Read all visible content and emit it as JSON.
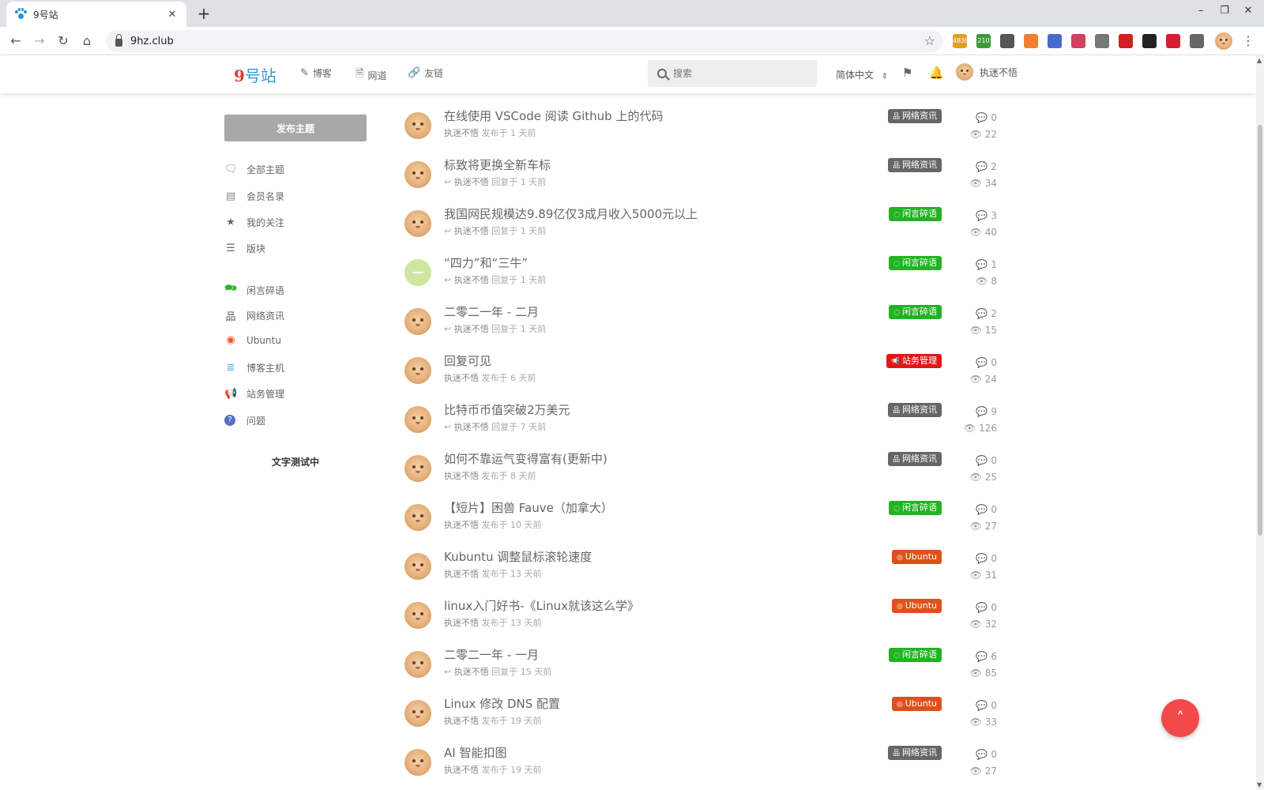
{
  "browser": {
    "tab_title": "9号站",
    "url": "9hz.club",
    "extensions": [
      {
        "name": "ext-badge-icon",
        "label": "4839",
        "color": "#e0a020"
      },
      {
        "name": "ext-badge-icon",
        "label": "210",
        "color": "#3a9a3a"
      },
      {
        "name": "mail-icon",
        "label": "",
        "color": "#555555"
      },
      {
        "name": "ext-icon",
        "label": "",
        "color": "#f08030"
      },
      {
        "name": "calendar-icon",
        "label": "",
        "color": "#4a6ad0"
      },
      {
        "name": "ext-icon",
        "label": "",
        "color": "#d04060"
      },
      {
        "name": "ext-icon",
        "label": "",
        "color": "#777777"
      },
      {
        "name": "ext-icon",
        "label": "",
        "color": "#d02020"
      },
      {
        "name": "ext-icon",
        "label": "",
        "color": "#222222"
      },
      {
        "name": "heart-icon",
        "label": "",
        "color": "#d02030"
      },
      {
        "name": "puzzle-icon",
        "label": "",
        "color": "#666666"
      }
    ]
  },
  "header": {
    "logo_num": "9",
    "logo_text": "号站",
    "nav": [
      {
        "label": "博客",
        "icon": "blog-icon"
      },
      {
        "label": "网道",
        "icon": "doc-icon"
      },
      {
        "label": "友链",
        "icon": "link-icon"
      }
    ],
    "search_placeholder": "搜索",
    "language": "简体中文",
    "username": "执迷不悟"
  },
  "sidebar": {
    "publish_label": "发布主题",
    "main_nav": [
      {
        "label": "全部主题",
        "icon": "comments-icon",
        "color": "#888888"
      },
      {
        "label": "会员名录",
        "icon": "address-book-icon",
        "color": "#888888"
      },
      {
        "label": "我的关注",
        "icon": "star-icon",
        "color": "#666666"
      },
      {
        "label": "版块",
        "icon": "list-icon",
        "color": "#666666"
      }
    ],
    "categories": [
      {
        "label": "闲言碎语",
        "icon": "chat-icon",
        "color": "#33b233"
      },
      {
        "label": "网络资讯",
        "icon": "sitemap-icon",
        "color": "#555555"
      },
      {
        "label": "Ubuntu",
        "icon": "ubuntu-icon",
        "color": "#e95420"
      },
      {
        "label": "博客主机",
        "icon": "server-icon",
        "color": "#4fb3d9"
      },
      {
        "label": "站务管理",
        "icon": "megaphone-icon",
        "color": "#e02020"
      },
      {
        "label": "问题",
        "icon": "question-icon",
        "color": "#5570c0"
      }
    ],
    "footer_text": "文字测试中"
  },
  "tag_styles": {
    "网络资讯": {
      "color": "#666666",
      "icon": "sitemap-icon",
      "glyph": "品"
    },
    "闲言碎语": {
      "color": "#22b322",
      "icon": "chat-icon",
      "glyph": "◌"
    },
    "站务管理": {
      "color": "#e01818",
      "icon": "megaphone-icon",
      "glyph": "📢"
    },
    "Ubuntu": {
      "color": "#e0501c",
      "icon": "ubuntu-icon",
      "glyph": "◎"
    }
  },
  "topics": [
    {
      "title": "在线使用 VSCode 阅读 Github 上的代码",
      "user": "执迷不悟",
      "action": "发布于 1 天前",
      "replied": false,
      "tag": "网络资讯",
      "replies": "0",
      "views": "22",
      "avatar": "face"
    },
    {
      "title": "标致将更换全新车标",
      "user": "执迷不悟",
      "action": "回复于 1 天前",
      "replied": true,
      "tag": "网络资讯",
      "replies": "2",
      "views": "34",
      "avatar": "face"
    },
    {
      "title": "我国网民规模达9.89亿仅3成月收入5000元以上",
      "user": "执迷不悟",
      "action": "回复于 1 天前",
      "replied": true,
      "tag": "闲言碎语",
      "replies": "3",
      "views": "40",
      "avatar": "face"
    },
    {
      "title": "“四力”和“三牛”",
      "user": "执迷不悟",
      "action": "回复于 1 天前",
      "replied": true,
      "tag": "闲言碎语",
      "replies": "1",
      "views": "8",
      "avatar": "green"
    },
    {
      "title": "二零二一年 - 二月",
      "user": "执迷不悟",
      "action": "回复于 1 天前",
      "replied": true,
      "tag": "闲言碎语",
      "replies": "2",
      "views": "15",
      "avatar": "face"
    },
    {
      "title": "回复可见",
      "user": "执迷不悟",
      "action": "发布于 6 天前",
      "replied": false,
      "tag": "站务管理",
      "replies": "0",
      "views": "24",
      "avatar": "face"
    },
    {
      "title": "比特币币值突破2万美元",
      "user": "执迷不悟",
      "action": "回复于 7 天前",
      "replied": true,
      "tag": "网络资讯",
      "replies": "9",
      "views": "126",
      "avatar": "face"
    },
    {
      "title": "如何不靠运气变得富有(更新中)",
      "user": "执迷不悟",
      "action": "发布于 8 天前",
      "replied": false,
      "tag": "网络资讯",
      "replies": "0",
      "views": "25",
      "avatar": "face"
    },
    {
      "title": "【短片】困兽 Fauve（加拿大）",
      "user": "执迷不悟",
      "action": "发布于 10 天前",
      "replied": false,
      "tag": "闲言碎语",
      "replies": "0",
      "views": "27",
      "avatar": "face"
    },
    {
      "title": "Kubuntu 调整鼠标滚轮速度",
      "user": "执迷不悟",
      "action": "发布于 13 天前",
      "replied": false,
      "tag": "Ubuntu",
      "replies": "0",
      "views": "31",
      "avatar": "face"
    },
    {
      "title": "linux入门好书-《Linux就该这么学》",
      "user": "执迷不悟",
      "action": "发布于 13 天前",
      "replied": false,
      "tag": "Ubuntu",
      "replies": "0",
      "views": "32",
      "avatar": "face"
    },
    {
      "title": "二零二一年 - 一月",
      "user": "执迷不悟",
      "action": "回复于 15 天前",
      "replied": true,
      "tag": "闲言碎语",
      "replies": "6",
      "views": "85",
      "avatar": "face"
    },
    {
      "title": "Linux 修改 DNS 配置",
      "user": "执迷不悟",
      "action": "发布于 19 天前",
      "replied": false,
      "tag": "Ubuntu",
      "replies": "0",
      "views": "33",
      "avatar": "face"
    },
    {
      "title": "AI 智能扣图",
      "user": "执迷不悟",
      "action": "发布于 19 天前",
      "replied": false,
      "tag": "网络资讯",
      "replies": "0",
      "views": "27",
      "avatar": "face"
    }
  ],
  "scroll_top_label": "˄"
}
